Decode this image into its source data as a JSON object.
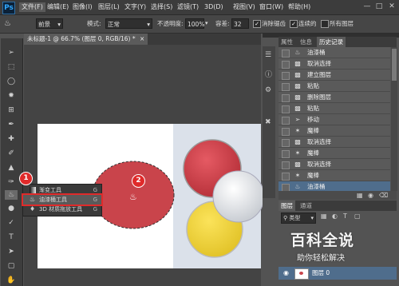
{
  "menubar": {
    "logo": "Ps",
    "items": [
      "文件(F)",
      "编辑(E)",
      "图像(I)",
      "图层(L)",
      "文字(Y)",
      "选择(S)",
      "滤镜(T)",
      "3D(D)",
      "视图(V)",
      "窗口(W)",
      "帮助(H)"
    ],
    "window_buttons": [
      "—",
      "□",
      "✕"
    ]
  },
  "options": {
    "fill_select": "前景",
    "mode_label": "模式:",
    "mode_value": "正常",
    "opacity_label": "不透明度:",
    "opacity_value": "100%",
    "tolerance_label": "容差:",
    "tolerance_value": "32",
    "antialias_label": "消除锯齿",
    "contiguous_label": "连续的",
    "all_layers_label": "所有图层"
  },
  "document": {
    "tab_title": "未标题-1 @ 66.7% (图层 0, RGB/16) *",
    "tab_close": "×"
  },
  "flyout": {
    "items": [
      {
        "label": "渐变工具",
        "key": "G"
      },
      {
        "label": "油漆桶工具",
        "key": "G"
      },
      {
        "label": "3D 材质拖放工具",
        "key": "G"
      }
    ]
  },
  "badges": {
    "one": "1",
    "two": "2"
  },
  "panel_tabs": {
    "history": [
      "属性",
      "信息",
      "历史记录"
    ],
    "layers": [
      "图层",
      "通道"
    ]
  },
  "history": {
    "items": [
      {
        "icon": "paint-bucket",
        "label": "油漆桶"
      },
      {
        "icon": "step",
        "label": "取消选择"
      },
      {
        "icon": "step",
        "label": "建立图层"
      },
      {
        "icon": "step",
        "label": "粘贴"
      },
      {
        "icon": "step",
        "label": "删除图层"
      },
      {
        "icon": "step",
        "label": "粘贴"
      },
      {
        "icon": "move",
        "label": "移动"
      },
      {
        "icon": "magic-wand",
        "label": "魔棒"
      },
      {
        "icon": "step",
        "label": "取消选择"
      },
      {
        "icon": "magic-wand",
        "label": "魔棒"
      },
      {
        "icon": "step",
        "label": "取消选择"
      },
      {
        "icon": "magic-wand",
        "label": "魔棒"
      },
      {
        "icon": "paint-bucket",
        "label": "油漆桶"
      }
    ]
  },
  "layers": {
    "kind_label": "类型",
    "layer_name": "图层 0"
  },
  "watermark": {
    "title": "百科全说",
    "subtitle": "助你轻松解决"
  },
  "colors": {
    "selection_fill": "#c9444b",
    "accent_red": "#e02a2a",
    "selected_row": "#4f6d8c"
  }
}
